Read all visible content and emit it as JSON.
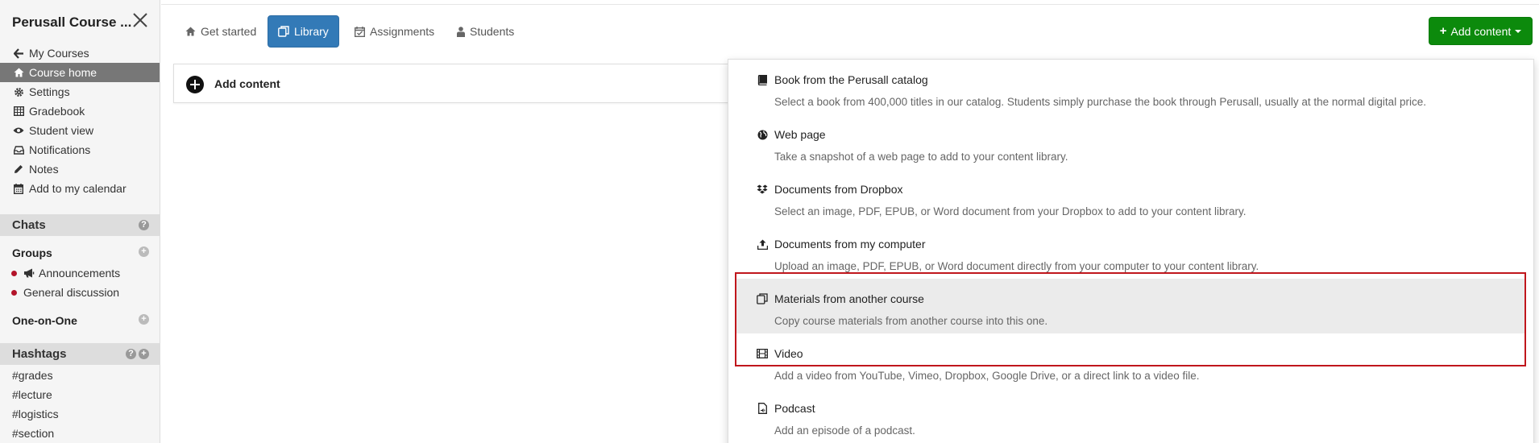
{
  "sidebar": {
    "title": "Perusall Course ...",
    "nav": [
      {
        "label": "My Courses",
        "icon": "arrow-left-icon",
        "active": false
      },
      {
        "label": "Course home",
        "icon": "home-icon",
        "active": true
      },
      {
        "label": "Settings",
        "icon": "gear-icon",
        "active": false
      },
      {
        "label": "Gradebook",
        "icon": "table-icon",
        "active": false
      },
      {
        "label": "Student view",
        "icon": "eye-icon",
        "active": false
      },
      {
        "label": "Notifications",
        "icon": "inbox-icon",
        "active": false
      },
      {
        "label": "Notes",
        "icon": "pencil-icon",
        "active": false
      },
      {
        "label": "Add to my calendar",
        "icon": "calendar-icon",
        "active": false
      }
    ],
    "chats": {
      "label": "Chats"
    },
    "groups": {
      "label": "Groups",
      "items": [
        "Announcements",
        "General discussion"
      ]
    },
    "one_on_one": {
      "label": "One-on-One"
    },
    "hashtags": {
      "label": "Hashtags",
      "items": [
        "#grades",
        "#lecture",
        "#logistics",
        "#section"
      ]
    }
  },
  "tabs": [
    {
      "label": "Get started",
      "icon": "home-icon"
    },
    {
      "label": "Library",
      "icon": "copy-icon"
    },
    {
      "label": "Assignments",
      "icon": "calendar-check-icon"
    },
    {
      "label": "Students",
      "icon": "user-icon"
    }
  ],
  "add_content_button": "Add content",
  "content_box": {
    "label": "Add content"
  },
  "dropdown": [
    {
      "title": "Book from the Perusall catalog",
      "desc": "Select a book from 400,000 titles in our catalog. Students simply purchase the book through Perusall, usually at the normal digital price.",
      "icon": "book-icon"
    },
    {
      "title": "Web page",
      "desc": "Take a snapshot of a web page to add to your content library.",
      "icon": "globe-icon"
    },
    {
      "title": "Documents from Dropbox",
      "desc": "Select an image, PDF, EPUB, or Word document from your Dropbox to add to your content library.",
      "icon": "dropbox-icon"
    },
    {
      "title": "Documents from my computer",
      "desc": "Upload an image, PDF, EPUB, or Word document directly from your computer to your content library.",
      "icon": "upload-icon"
    },
    {
      "title": "Materials from another course",
      "desc": "Copy course materials from another course into this one.",
      "icon": "copy-icon"
    },
    {
      "title": "Video",
      "desc": "Add a video from YouTube, Vimeo, Dropbox, Google Drive, or a direct link to a video file.",
      "icon": "film-icon"
    },
    {
      "title": "Podcast",
      "desc": "Add an episode of a podcast.",
      "icon": "audio-file-icon"
    }
  ],
  "colors": {
    "primary": "#337ab7",
    "success": "#0c8a0c",
    "highlight": "#c0161c",
    "active_nav": "#777777"
  }
}
